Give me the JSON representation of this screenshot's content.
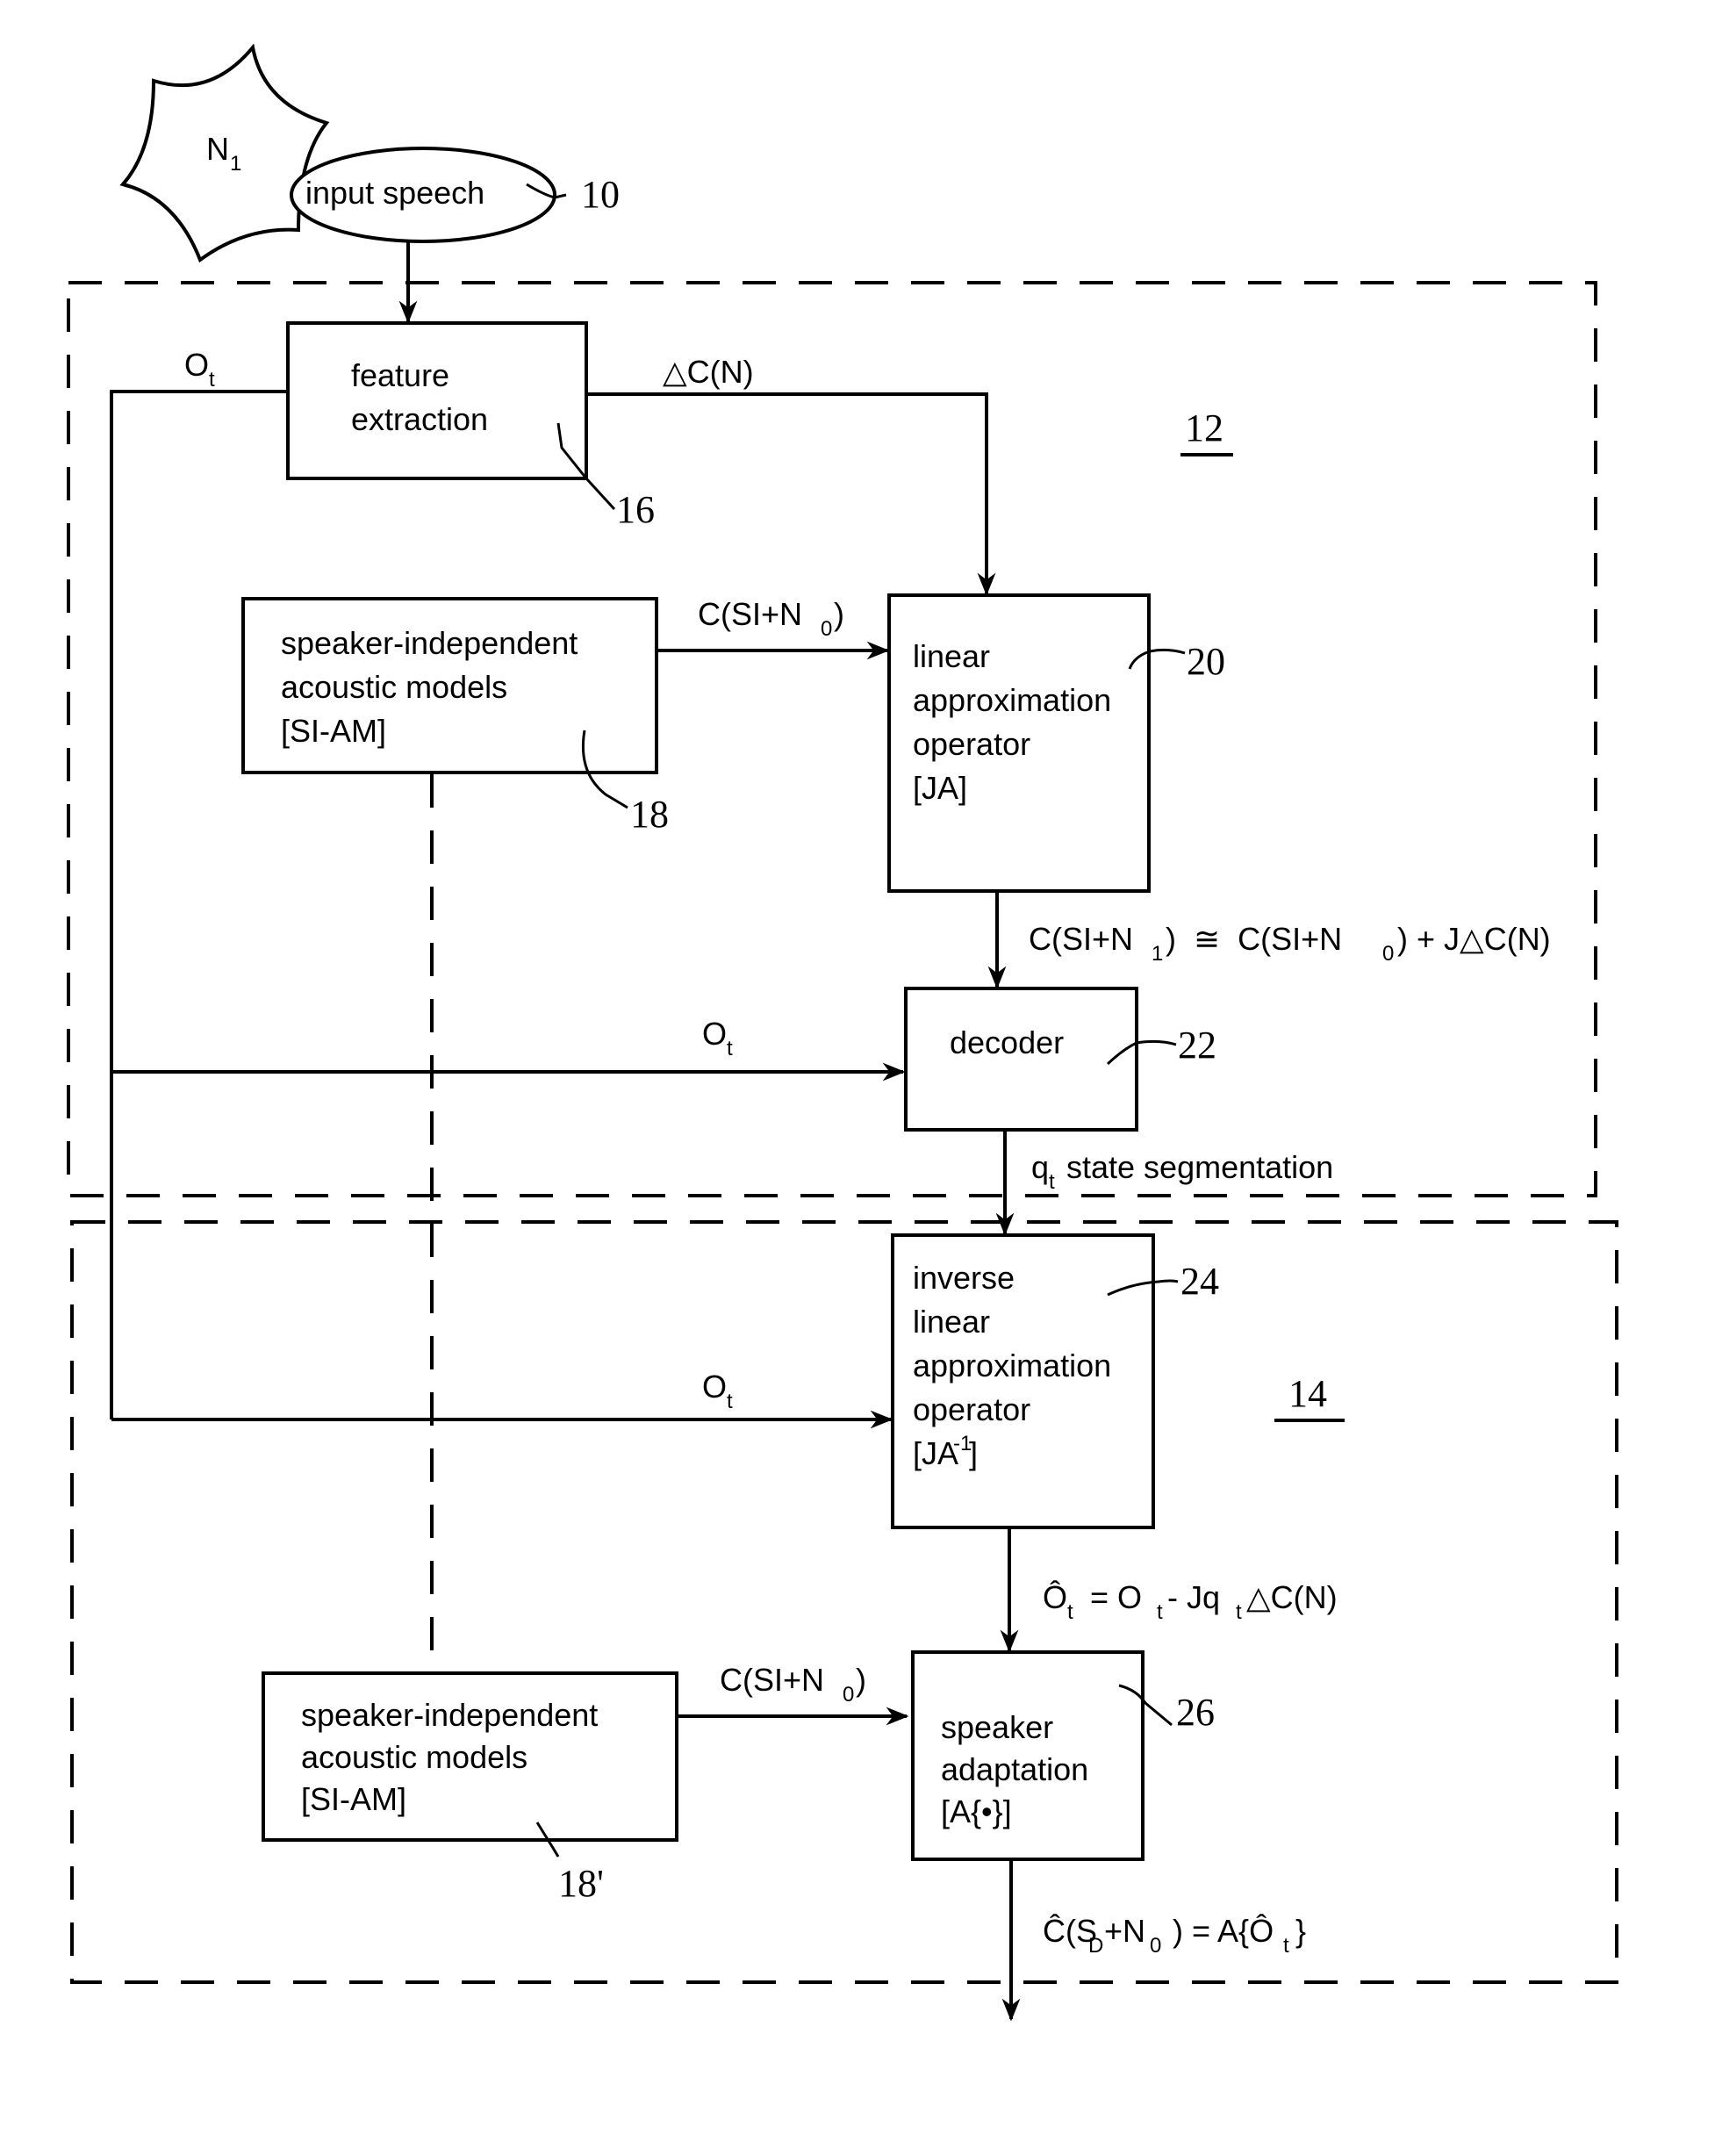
{
  "figure": {
    "noise_source": {
      "label": "N",
      "subscript": "1"
    },
    "input": {
      "label": "input speech",
      "ref": "10"
    },
    "groups": [
      {
        "ref": "12"
      },
      {
        "ref": "14"
      }
    ],
    "blocks": {
      "feature_extraction": {
        "lines": [
          "feature",
          "extraction"
        ],
        "ref": "16"
      },
      "si_am_top": {
        "lines": [
          "speaker-independent",
          "acoustic models",
          "[SI-AM]"
        ],
        "ref": "18"
      },
      "linear_approx": {
        "lines": [
          "linear",
          "approximation",
          "operator",
          "[JA]"
        ],
        "ref": "20"
      },
      "decoder": {
        "lines": [
          "decoder"
        ],
        "ref": "22"
      },
      "inverse_linear_approx": {
        "lines": [
          "inverse",
          "linear",
          "approximation",
          "operator",
          "[JA",
          "-1",
          "]"
        ],
        "ref": "24"
      },
      "speaker_adaptation": {
        "lines": [
          "speaker",
          "adaptation",
          "[A{•}]"
        ],
        "ref": "26"
      },
      "si_am_bottom": {
        "lines": [
          "speaker-independent",
          "acoustic models",
          "[SI-AM]"
        ],
        "ref": "18'"
      }
    },
    "signals": {
      "ot_top": {
        "main": "O",
        "sub": "t"
      },
      "delta_cn": "△C(N)",
      "c_si_n0_top": {
        "main": "C(SI+N",
        "sub": "0",
        "end": ")"
      },
      "c_si_n1_eq": {
        "a": "C(SI+N",
        "a_sub": "1",
        "b": ")  ≅  C(SI+N",
        "b_sub": "0",
        "c": ") + J△C(N)"
      },
      "ot_decoder": {
        "main": "O",
        "sub": "t"
      },
      "state_seg": {
        "main": "q",
        "sub": "t",
        "rest": " state segmentation"
      },
      "ot_inverse": {
        "main": "O",
        "sub": "t"
      },
      "ohat_eq": {
        "a": "Ô",
        "a_sub": "t",
        "b": " = O",
        "b_sub": "t",
        "c": "- Jq",
        "c_sub": "t",
        "d": "△C(N)"
      },
      "c_si_n0_bottom": {
        "main": "C(SI+N",
        "sub": "0",
        "end": ")"
      },
      "output_eq": {
        "a": "Ĉ(S",
        "a_sub": "D",
        "b": "+N",
        "b_sub": "0",
        "c": " ) = A{Ô",
        "c_sub": "t",
        "d": "}"
      }
    }
  }
}
